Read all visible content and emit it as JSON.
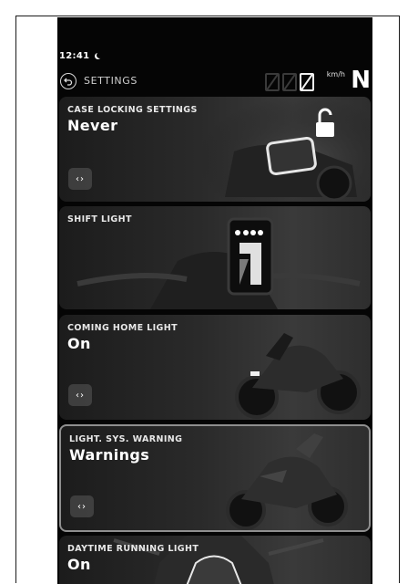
{
  "status": {
    "time": "12:41"
  },
  "header": {
    "title": "SETTINGS",
    "speed_unit": "km/h",
    "gear": "N"
  },
  "cards": [
    {
      "label": "CASE LOCKING SETTINGS",
      "value": "Never",
      "nav": "‹›",
      "selected": false
    },
    {
      "label": "SHIFT LIGHT",
      "selected": false
    },
    {
      "label": "COMING HOME LIGHT",
      "value": "On",
      "nav": "‹›",
      "selected": false
    },
    {
      "label": "LIGHT. SYS. WARNING",
      "value": "Warnings",
      "nav": "‹›",
      "selected": true
    },
    {
      "label": "DAYTIME RUNNING LIGHT",
      "value": "On",
      "selected": false
    }
  ],
  "icons": {
    "moon": "moon-icon",
    "back": "back-icon",
    "unlock": "unlock-icon"
  }
}
